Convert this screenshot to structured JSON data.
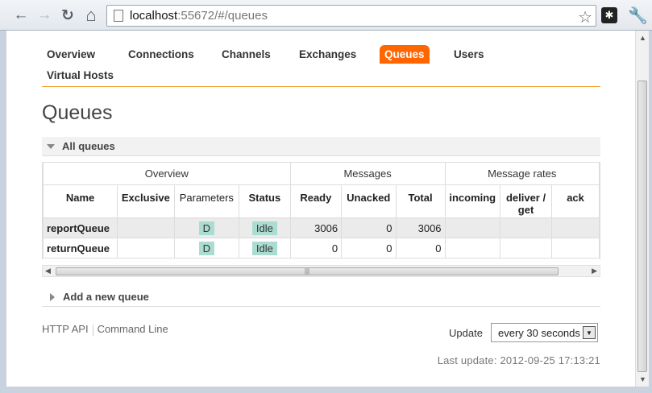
{
  "browser": {
    "url_host": "localhost",
    "url_path": ":55672/#/queues",
    "back_glyph": "←",
    "forward_glyph": "→",
    "reload_glyph": "↻",
    "home_glyph": "⌂",
    "star_glyph": "☆",
    "ext_glyph": "✱",
    "wrench_glyph": "🔧"
  },
  "nav": {
    "tabs": [
      "Overview",
      "Connections",
      "Channels",
      "Exchanges",
      "Queues",
      "Users",
      "Virtual Hosts"
    ],
    "active": "Queues"
  },
  "page_title": "Queues",
  "all_queues_label": "All queues",
  "table": {
    "groups": [
      "Overview",
      "Messages",
      "Message rates"
    ],
    "columns": [
      "Name",
      "Exclusive",
      "Parameters",
      "Status",
      "Ready",
      "Unacked",
      "Total",
      "incoming",
      "deliver / get",
      "ack"
    ],
    "rows": [
      {
        "name": "reportQueue",
        "exclusive": "",
        "parameters": "D",
        "status": "Idle",
        "ready": "3006",
        "unacked": "0",
        "total": "3006",
        "incoming": "",
        "deliver_get": "",
        "ack": ""
      },
      {
        "name": "returnQueue",
        "exclusive": "",
        "parameters": "D",
        "status": "Idle",
        "ready": "0",
        "unacked": "0",
        "total": "0",
        "incoming": "",
        "deliver_get": "",
        "ack": ""
      }
    ]
  },
  "add_queue_label": "Add a new queue",
  "footer": {
    "http_api": "HTTP API",
    "command_line": "Command Line",
    "update_label": "Update",
    "update_value": "every 30 seconds",
    "last_update": "Last update: 2012-09-25 17:13:21"
  }
}
